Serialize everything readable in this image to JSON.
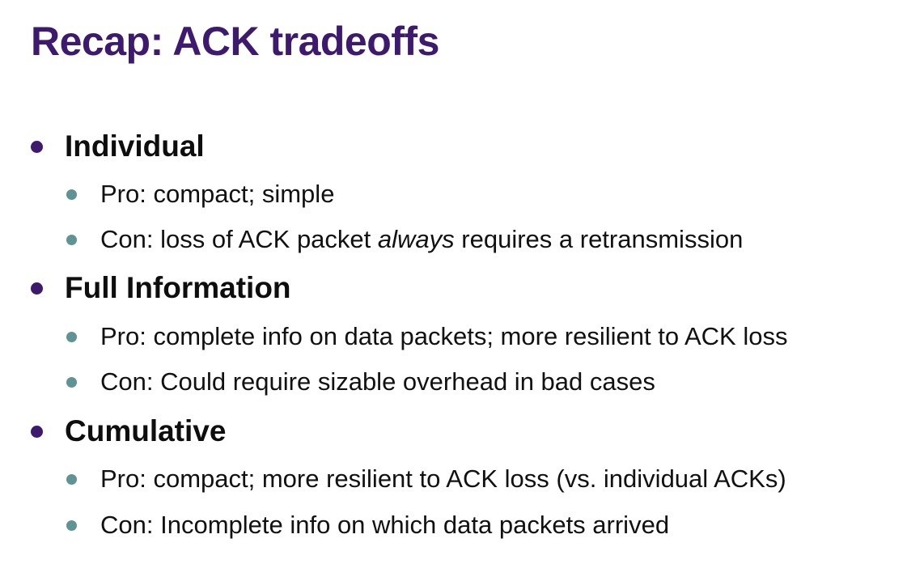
{
  "title": "Recap: ACK tradeoffs",
  "colors": {
    "title": "#3d1a6e",
    "level1_bullet": "#3d1a6e",
    "level2_bullet": "#5f9494",
    "text": "#111111"
  },
  "sections": [
    {
      "heading": "Individual",
      "points": [
        {
          "before": "Pro: compact; simple",
          "emph": "",
          "after": ""
        },
        {
          "before": "Con: loss of ACK packet ",
          "emph": "always",
          "after": " requires a retransmission"
        }
      ]
    },
    {
      "heading": "Full Information",
      "points": [
        {
          "before": "Pro: complete info on data packets; more resilient to ACK loss",
          "emph": "",
          "after": ""
        },
        {
          "before": "Con: Could require sizable overhead in bad cases",
          "emph": "",
          "after": ""
        }
      ]
    },
    {
      "heading": "Cumulative",
      "points": [
        {
          "before": "Pro: compact; more resilient to ACK loss (vs. individual ACKs)",
          "emph": "",
          "after": ""
        },
        {
          "before": "Con: Incomplete info on which data packets arrived",
          "emph": "",
          "after": ""
        }
      ]
    }
  ]
}
